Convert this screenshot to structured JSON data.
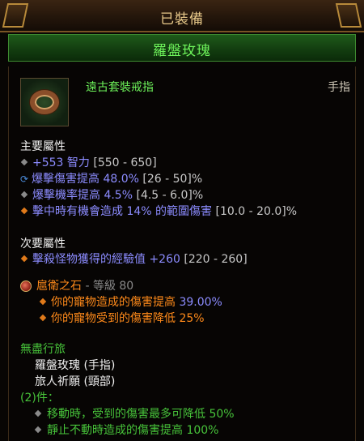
{
  "header": {
    "title": "已裝備"
  },
  "item": {
    "name": "羅盤玫瑰",
    "type": "遠古套裝戒指",
    "slot": "手指"
  },
  "primary": {
    "title": "主要屬性",
    "lines": [
      {
        "value": "+553 智力",
        "range": "[550 - 650]"
      },
      {
        "value": "爆擊傷害提高 48.0%",
        "range": "[26 - 50]%"
      },
      {
        "value": "爆擊機率提高 4.5%",
        "range": "[4.5 - 6.0]%"
      },
      {
        "value": "擊中時有機會造成 14% 的範圍傷害",
        "range": "[10.0 - 20.0]%"
      }
    ]
  },
  "secondary": {
    "title": "次要屬性",
    "lines": [
      {
        "prefix": "擊殺怪物獲得的經驗值 ",
        "value": "+260",
        "range": "[220 - 260]"
      }
    ]
  },
  "gem": {
    "name": "扈衛之石",
    "rank": "- 等級 80",
    "effects": [
      {
        "prefix": "你的寵物造成的傷害提高 ",
        "value": "39.00%"
      },
      {
        "prefix": "你的寵物受到的傷害降低 ",
        "value": "25%"
      }
    ]
  },
  "set": {
    "name": "無盡行旅",
    "pieces": [
      "羅盤玫瑰 (手指)",
      "旅人祈願 (頸部)"
    ],
    "bonus_title": "(2)件：",
    "bonuses": [
      "移動時，受到的傷害最多可降低 50%",
      "靜止不動時造成的傷害提高 100%"
    ]
  },
  "colors": {
    "set_green": "#6df25a",
    "affix_blue": "#8c8cff",
    "legendary_orange": "#ff8a1a",
    "gold_frame": "#b88a3a"
  }
}
